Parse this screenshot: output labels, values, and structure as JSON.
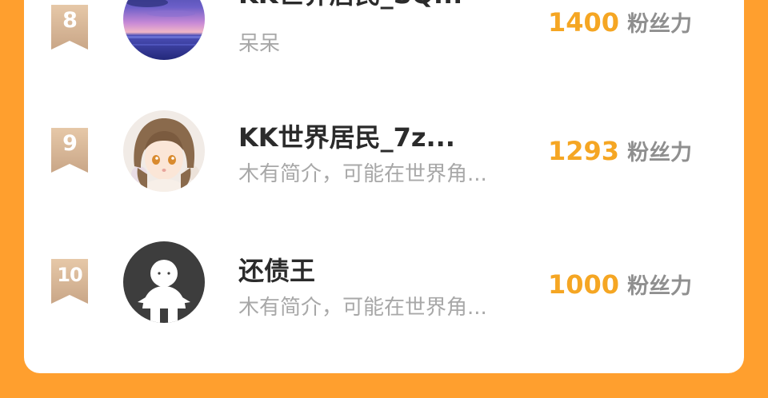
{
  "leaderboard": {
    "rows": [
      {
        "rank": "8",
        "name": "KK世界居民_SQ...",
        "bio": "呆呆",
        "score": "1400",
        "unit": "粉丝力"
      },
      {
        "rank": "9",
        "name": "KK世界居民_7z...",
        "bio": "木有简介，可能在世界角...",
        "score": "1293",
        "unit": "粉丝力"
      },
      {
        "rank": "10",
        "name": "还债王",
        "bio": "木有简介，可能在世界角...",
        "score": "1000",
        "unit": "粉丝力"
      }
    ]
  },
  "colors": {
    "background": "#FF9F2E",
    "card": "#FFFFFF",
    "score": "#F5A623",
    "badge_top": "#E6C8A8",
    "badge_bottom": "#C9A687"
  }
}
